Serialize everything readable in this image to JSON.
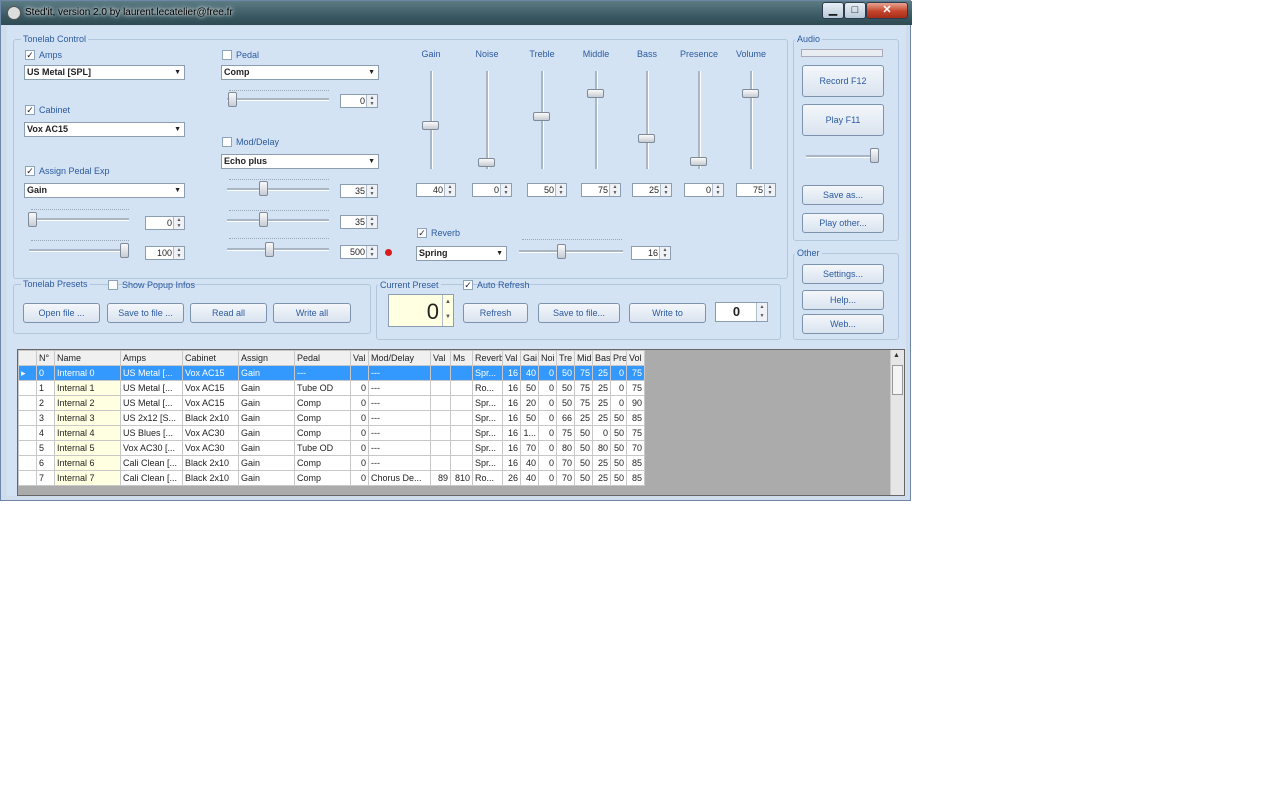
{
  "window": {
    "title": "Sted'it, version 2.0 by laurent.lecatelier@free.fr",
    "minimize": "▁",
    "maximize": "□",
    "close": "✕"
  },
  "tonelab": {
    "group_label": "Tonelab Control",
    "amps": {
      "label": "Amps",
      "checked": true,
      "value": "US Metal [SPL]"
    },
    "cabinet": {
      "label": "Cabinet",
      "checked": true,
      "value": "Vox AC15"
    },
    "assign": {
      "label": "Assign Pedal Exp",
      "checked": true,
      "value": "Gain",
      "min": "0",
      "max": "100",
      "min_level": 0,
      "max_level": 1
    },
    "pedal": {
      "label": "Pedal",
      "checked": false,
      "value": "Comp",
      "level": "0"
    },
    "moddelay": {
      "label": "Mod/Delay",
      "checked": false,
      "value": "Echo plus",
      "p1": "35",
      "p2": "35",
      "p3": "500"
    },
    "reverb": {
      "label": "Reverb",
      "checked": true,
      "value": "Spring",
      "level": "16"
    },
    "faders": [
      {
        "label": "Gain",
        "value": "40"
      },
      {
        "label": "Noise",
        "value": "0"
      },
      {
        "label": "Treble",
        "value": "50"
      },
      {
        "label": "Middle",
        "value": "75"
      },
      {
        "label": "Bass",
        "value": "25"
      },
      {
        "label": "Presence",
        "value": "0"
      },
      {
        "label": "Volume",
        "value": "75"
      }
    ]
  },
  "presets": {
    "group_label": "Tonelab Presets",
    "show_popup": "Show Popup Infos",
    "buttons": [
      "Open file ...",
      "Save to file ...",
      "Read all",
      "Write all"
    ]
  },
  "current": {
    "group_label": "Current Preset",
    "auto_refresh": "Auto Refresh",
    "value": "0",
    "buttons": [
      "Refresh",
      "Save to file...",
      "Write to"
    ],
    "target": "0"
  },
  "audio": {
    "group_label": "Audio",
    "record": "Record F12",
    "play": "Play F11",
    "save_as": "Save as...",
    "play_other": "Play other..."
  },
  "other": {
    "group_label": "Other",
    "settings": "Settings...",
    "help": "Help...",
    "web": "Web..."
  },
  "table": {
    "columns": [
      "",
      "N°",
      "Name",
      "Amps",
      "Cabinet",
      "Assign",
      "Pedal",
      "Val",
      "Mod/Delay",
      "Val",
      "Ms",
      "Reverb",
      "Val",
      "Gai",
      "Noi",
      "Tre",
      "Mid",
      "Bas",
      "Pre",
      "Vol"
    ],
    "rows": [
      [
        "▸",
        "0",
        "Internal 0",
        "US Metal [...",
        "Vox AC15",
        "Gain",
        "---",
        "",
        "---",
        "",
        "",
        "Spr...",
        "16",
        "40",
        "0",
        "50",
        "75",
        "25",
        "0",
        "75"
      ],
      [
        "",
        "1",
        "Internal 1",
        "US Metal [...",
        "Vox AC15",
        "Gain",
        "Tube OD",
        "0",
        "---",
        "",
        "",
        "Ro...",
        "16",
        "50",
        "0",
        "50",
        "75",
        "25",
        "0",
        "75"
      ],
      [
        "",
        "2",
        "Internal 2",
        "US Metal [...",
        "Vox AC15",
        "Gain",
        "Comp",
        "0",
        "---",
        "",
        "",
        "Spr...",
        "16",
        "20",
        "0",
        "50",
        "75",
        "25",
        "0",
        "90"
      ],
      [
        "",
        "3",
        "Internal 3",
        "US 2x12 [S...",
        "Black 2x10",
        "Gain",
        "Comp",
        "0",
        "---",
        "",
        "",
        "Spr...",
        "16",
        "50",
        "0",
        "66",
        "25",
        "25",
        "50",
        "85"
      ],
      [
        "",
        "4",
        "Internal 4",
        "US Blues [...",
        "Vox AC30",
        "Gain",
        "Comp",
        "0",
        "---",
        "",
        "",
        "Spr...",
        "16",
        "1...",
        "0",
        "75",
        "50",
        "0",
        "50",
        "75"
      ],
      [
        "",
        "5",
        "Internal 5",
        "Vox AC30 [...",
        "Vox AC30",
        "Gain",
        "Tube OD",
        "0",
        "---",
        "",
        "",
        "Spr...",
        "16",
        "70",
        "0",
        "80",
        "50",
        "80",
        "50",
        "70"
      ],
      [
        "",
        "6",
        "Internal 6",
        "Cali Clean [...",
        "Black 2x10",
        "Gain",
        "Comp",
        "0",
        "---",
        "",
        "",
        "Spr...",
        "16",
        "40",
        "0",
        "70",
        "50",
        "25",
        "50",
        "85"
      ],
      [
        "",
        "7",
        "Internal 7",
        "Cali Clean [...",
        "Black 2x10",
        "Gain",
        "Comp",
        "0",
        "Chorus De...",
        "89",
        "810",
        "Ro...",
        "26",
        "40",
        "0",
        "70",
        "50",
        "25",
        "50",
        "85"
      ]
    ]
  }
}
